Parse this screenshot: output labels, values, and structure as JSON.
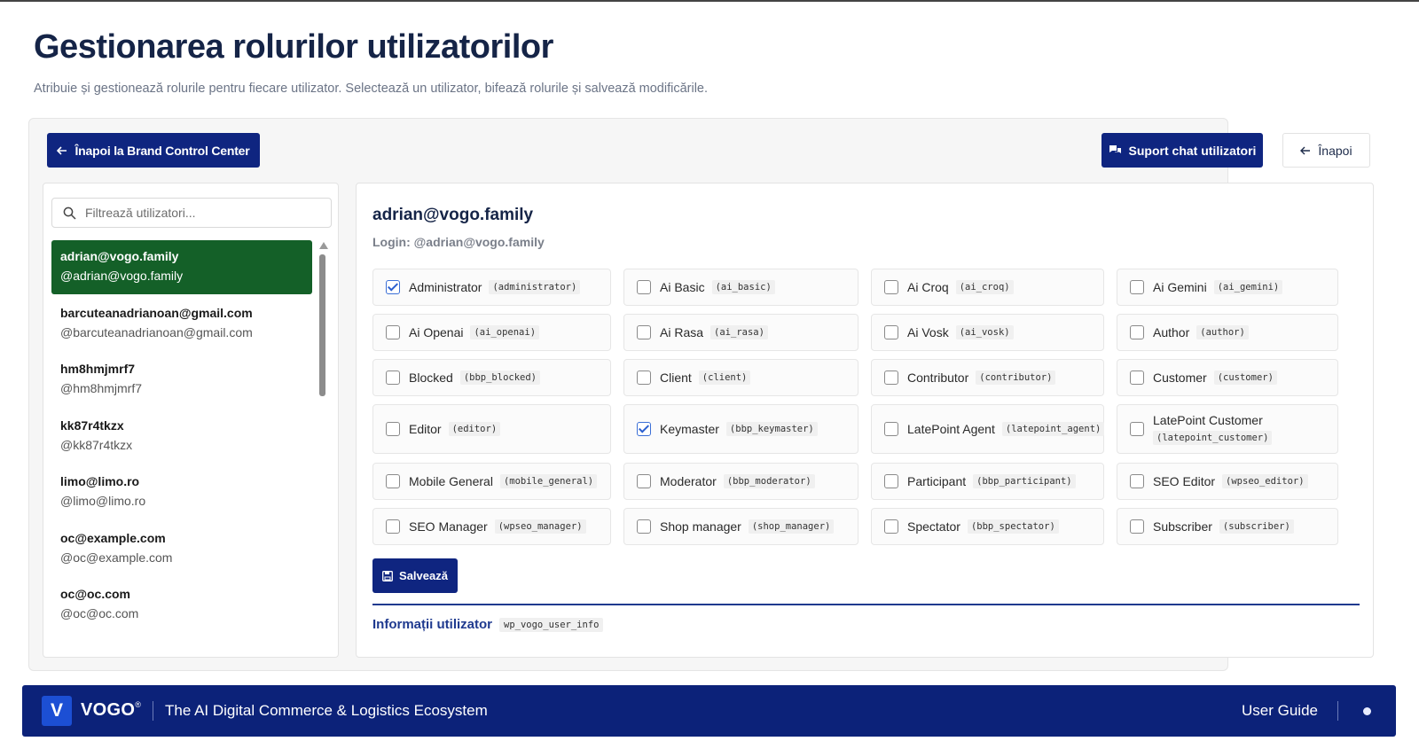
{
  "page": {
    "title": "Gestionarea rolurilor utilizatorilor",
    "subtitle": "Atribuie și gestionează rolurile pentru fiecare utilizator. Selectează un utilizator, bifează rolurile și salvează modificările."
  },
  "toolbar": {
    "back_bcc_label": "Înapoi la Brand Control Center",
    "support_label": "Suport chat utilizatori",
    "back_label": "Înapoi"
  },
  "users": {
    "search_placeholder": "Filtrează utilizatori...",
    "items": [
      {
        "name": "adrian@vogo.family",
        "login": "@adrian@vogo.family",
        "active": true
      },
      {
        "name": "barcuteanadrianoan@gmail.com",
        "login": "@barcuteanadrianoan@gmail.com",
        "active": false
      },
      {
        "name": "hm8hmjmrf7",
        "login": "@hm8hmjmrf7",
        "active": false
      },
      {
        "name": "kk87r4tkzx",
        "login": "@kk87r4tkzx",
        "active": false
      },
      {
        "name": "limo@limo.ro",
        "login": "@limo@limo.ro",
        "active": false
      },
      {
        "name": "oc@example.com",
        "login": "@oc@example.com",
        "active": false
      },
      {
        "name": "oc@oc.com",
        "login": "@oc@oc.com",
        "active": false
      }
    ]
  },
  "selected_user": {
    "name": "adrian@vogo.family",
    "login": "Login: @adrian@vogo.family"
  },
  "roles": [
    {
      "label": "Administrator",
      "code": "(administrator)",
      "checked": true
    },
    {
      "label": "Ai Basic",
      "code": "(ai_basic)",
      "checked": false
    },
    {
      "label": "Ai Croq",
      "code": "(ai_croq)",
      "checked": false
    },
    {
      "label": "Ai Gemini",
      "code": "(ai_gemini)",
      "checked": false
    },
    {
      "label": "Ai Openai",
      "code": "(ai_openai)",
      "checked": false
    },
    {
      "label": "Ai Rasa",
      "code": "(ai_rasa)",
      "checked": false
    },
    {
      "label": "Ai Vosk",
      "code": "(ai_vosk)",
      "checked": false
    },
    {
      "label": "Author",
      "code": "(author)",
      "checked": false
    },
    {
      "label": "Blocked",
      "code": "(bbp_blocked)",
      "checked": false
    },
    {
      "label": "Client",
      "code": "(client)",
      "checked": false
    },
    {
      "label": "Contributor",
      "code": "(contributor)",
      "checked": false
    },
    {
      "label": "Customer",
      "code": "(customer)",
      "checked": false
    },
    {
      "label": "Editor",
      "code": "(editor)",
      "checked": false
    },
    {
      "label": "Keymaster",
      "code": "(bbp_keymaster)",
      "checked": true
    },
    {
      "label": "LatePoint Agent",
      "code": "(latepoint_agent)",
      "checked": false
    },
    {
      "label": "LatePoint Customer",
      "code": "(latepoint_customer)",
      "checked": false
    },
    {
      "label": "Mobile General",
      "code": "(mobile_general)",
      "checked": false
    },
    {
      "label": "Moderator",
      "code": "(bbp_moderator)",
      "checked": false
    },
    {
      "label": "Participant",
      "code": "(bbp_participant)",
      "checked": false
    },
    {
      "label": "SEO Editor",
      "code": "(wpseo_editor)",
      "checked": false
    },
    {
      "label": "SEO Manager",
      "code": "(wpseo_manager)",
      "checked": false
    },
    {
      "label": "Shop manager",
      "code": "(shop_manager)",
      "checked": false
    },
    {
      "label": "Spectator",
      "code": "(bbp_spectator)",
      "checked": false
    },
    {
      "label": "Subscriber",
      "code": "(subscriber)",
      "checked": false
    }
  ],
  "actions": {
    "save_label": "Salvează"
  },
  "info": {
    "title": "Informații utilizator",
    "code": "wp_vogo_user_info"
  },
  "footer": {
    "logo_letter": "V",
    "brand": "VOGO",
    "brand_mark": "®",
    "tagline": "The AI Digital Commerce & Logistics Ecosystem",
    "user_guide": "User Guide"
  },
  "colors": {
    "primary": "#0f2580",
    "active_user": "#146028",
    "footer_bg": "#0c2279",
    "logo_bg": "#1c4fd4"
  },
  "icons": {
    "back_bcc": "arrow-left-icon",
    "support": "chat-bubbles-icon",
    "back": "arrow-left-icon",
    "search": "search-icon",
    "save": "floppy-disk-icon"
  }
}
